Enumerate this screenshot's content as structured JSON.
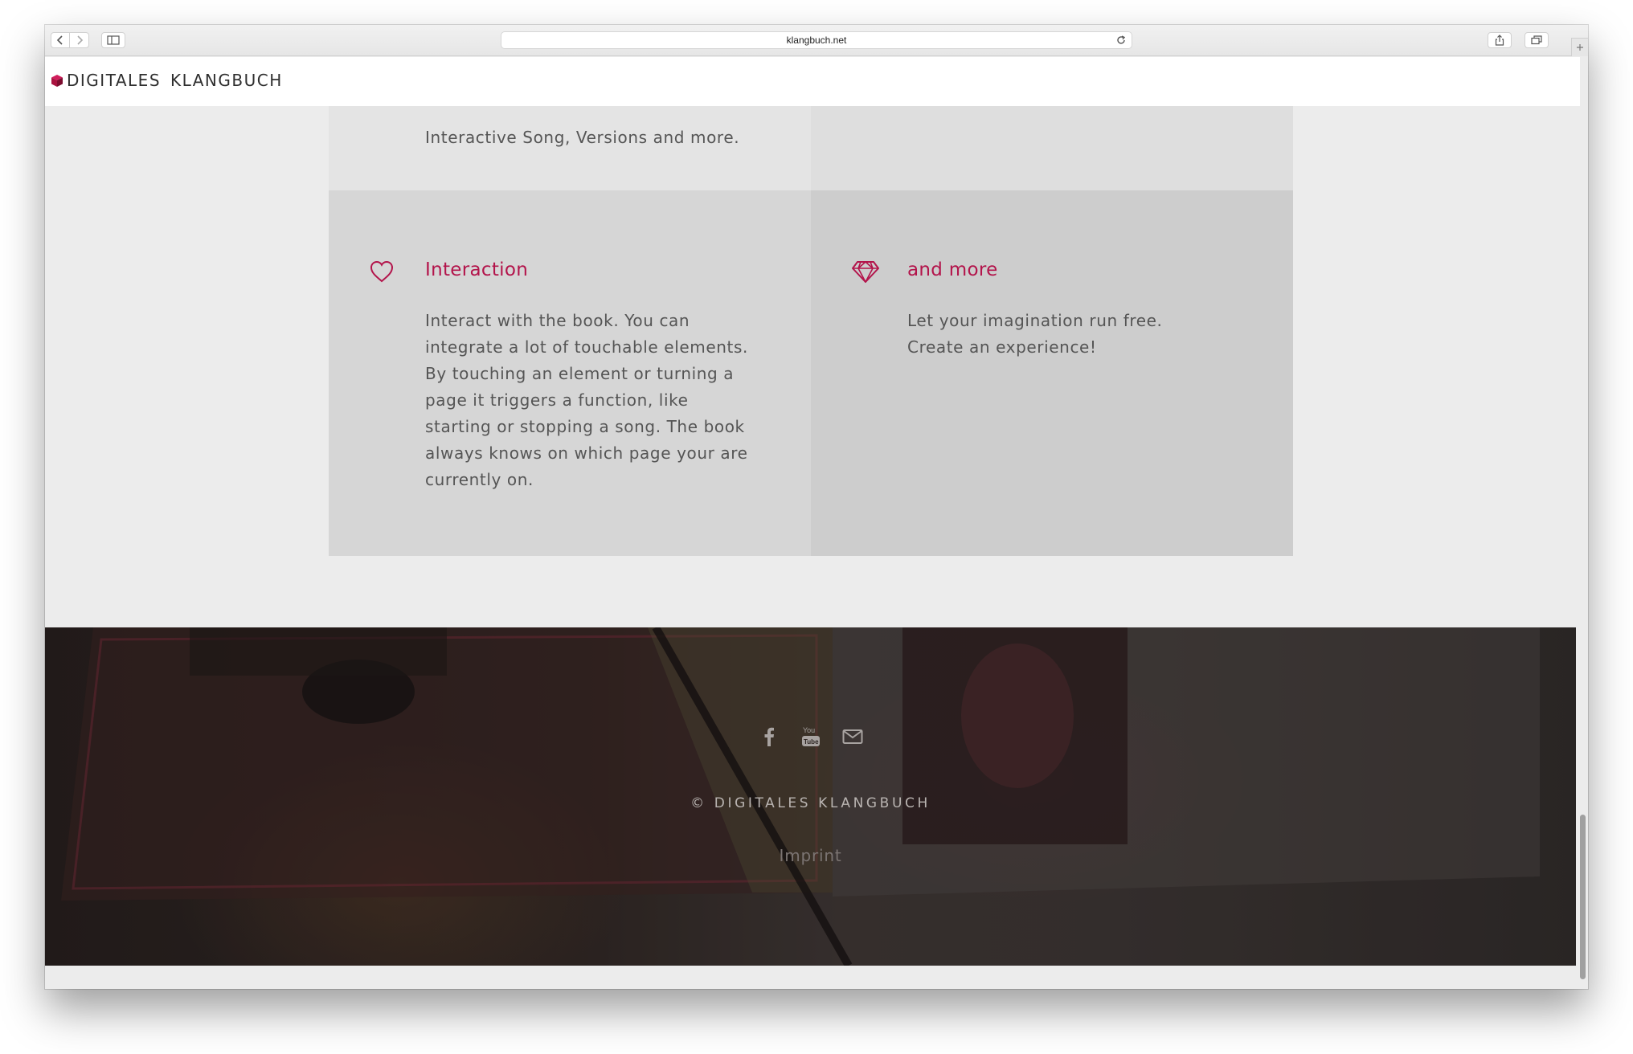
{
  "browser": {
    "url": "klangbuch.net"
  },
  "site": {
    "logo_word1": "DIGITALES",
    "logo_word2": "KLANGBUCH"
  },
  "features": {
    "previous_card_tail": "Interactive Song, Versions and more.",
    "interaction": {
      "icon": "heart-icon",
      "title": "Interaction",
      "body": "Interact with the book. You can integrate a lot of touchable elements. By touching an element or turning a page it triggers a function, like starting or stopping a song. The book always knows on which page your are currently on."
    },
    "more": {
      "icon": "diamond-icon",
      "title": "and more",
      "body": "Let your imagination run free. Create an experience!"
    }
  },
  "footer": {
    "social": [
      "facebook-icon",
      "youtube-icon",
      "mail-icon"
    ],
    "copyright": "© DIGITALES KLANGBUCH",
    "imprint": "Imprint"
  },
  "colors": {
    "accent": "#b3144b",
    "text": "#555555",
    "footer_dark": "#2e2623"
  }
}
